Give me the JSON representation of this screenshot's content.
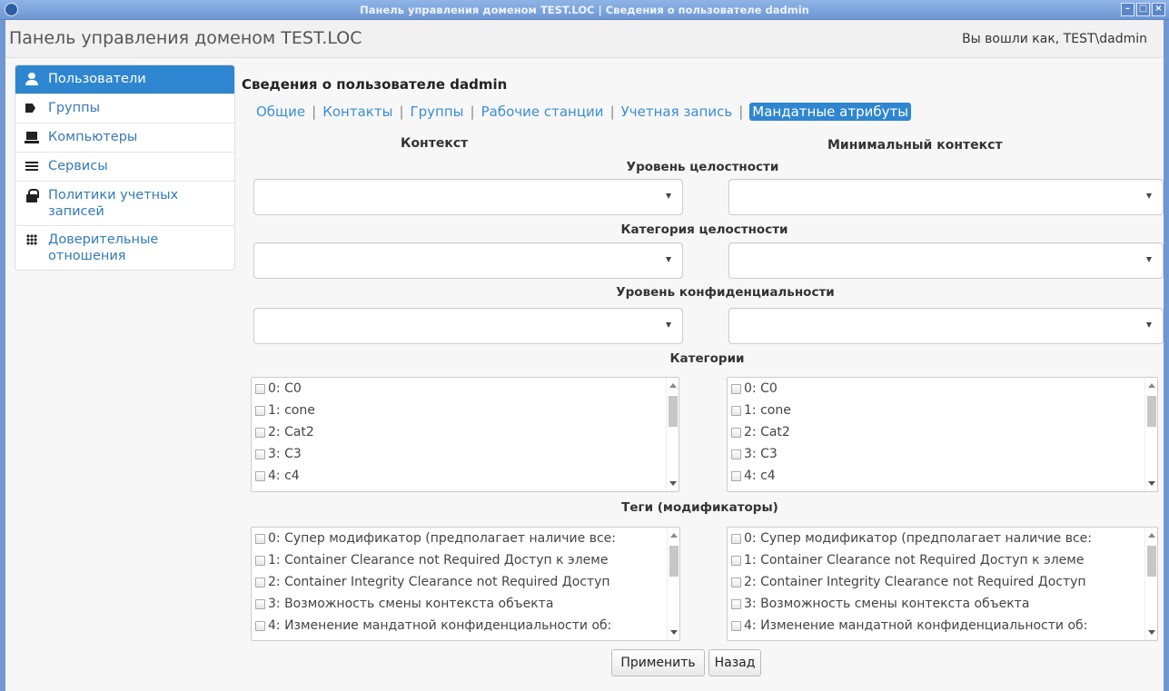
{
  "window": {
    "title": "Панель управления доменом TEST.LOC | Сведения о пользователе dadmin"
  },
  "header": {
    "app_title": "Панель управления доменом TEST.LOC",
    "logged_in": "Вы вошли как, TEST\\dadmin"
  },
  "sidebar": {
    "items": [
      {
        "label": "Пользователи",
        "icon": "user-icon",
        "active": true
      },
      {
        "label": "Группы",
        "icon": "tags-icon"
      },
      {
        "label": "Компьютеры",
        "icon": "computer-icon"
      },
      {
        "label": "Сервисы",
        "icon": "list-icon"
      },
      {
        "label": "Политики учетных\nзаписей",
        "icon": "lock-icon"
      },
      {
        "label": "Доверительные\nотношения",
        "icon": "grid-icon"
      }
    ]
  },
  "main": {
    "title": "Сведения о пользователе dadmin",
    "tabs": [
      "Общие",
      "Контакты",
      "Группы",
      "Рабочие станции",
      "Учетная запись",
      "Мандатные атрибуты"
    ],
    "active_tab": "Мандатные атрибуты",
    "col_context": "Контекст",
    "col_min_context": "Минимальный контекст",
    "sec_integrity_level": "Уровень целостности",
    "sec_integrity_category": "Категория целостности",
    "sec_conf_level": "Уровень конфиденциальности",
    "sec_categories": "Категории",
    "sec_tags": "Теги (модификаторы)",
    "categories": [
      "0: C0",
      "1: cone",
      "2: Cat2",
      "3: C3",
      "4: c4"
    ],
    "tags_left": [
      "0: Супер модификатор (предполагает наличие все:",
      "1: Container Clearance not Required Доступ к элеме",
      "2: Container Integrity Clearance not Required Доступ",
      "3: Возможность смены контекста объекта",
      "4: Изменение мандатной конфиденциальности об:"
    ],
    "tags_right": [
      "0: Супер модификатор (предполагает наличие все:",
      "1: Container Clearance not Required Доступ к элеме",
      "2: Container Integrity Clearance not Required Доступ",
      "3: Возможность смены контекста объекта",
      "4: Изменение мандатной конфиденциальности об:"
    ],
    "apply_label": "Применить",
    "back_label": "Назад"
  },
  "colors": {
    "accent": "#2f86d0",
    "link": "#337ab7",
    "titlebar": "#6e97d4"
  }
}
